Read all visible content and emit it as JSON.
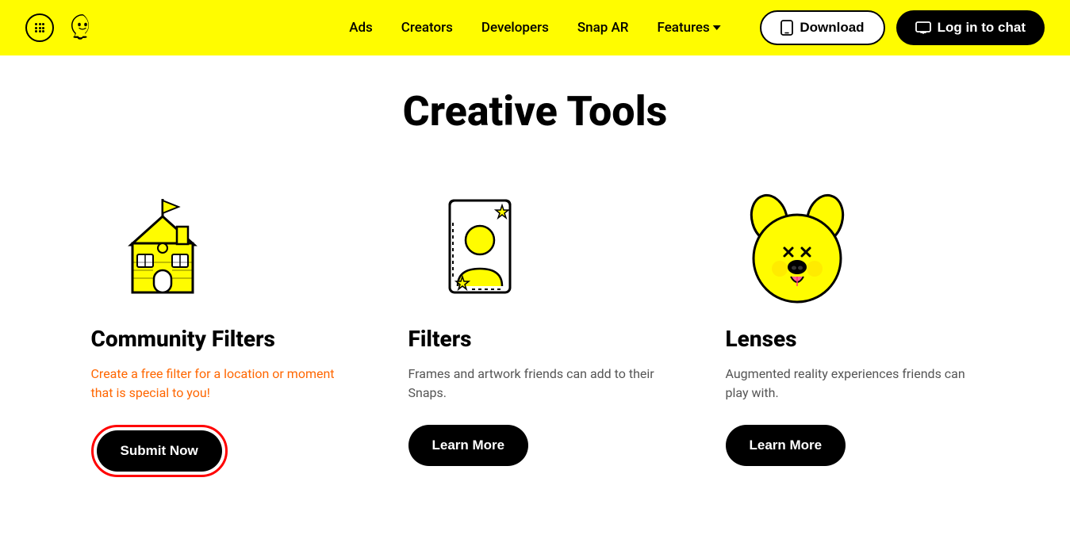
{
  "navbar": {
    "nav_links": [
      {
        "id": "ads",
        "label": "Ads"
      },
      {
        "id": "creators",
        "label": "Creators"
      },
      {
        "id": "developers",
        "label": "Developers"
      },
      {
        "id": "snap-ar",
        "label": "Snap AR"
      },
      {
        "id": "features",
        "label": "Features"
      }
    ],
    "download_label": "Download",
    "login_label": "Log in to chat"
  },
  "main": {
    "title": "Creative Tools",
    "cards": [
      {
        "id": "community-filters",
        "title": "Community Filters",
        "description_parts": [
          {
            "text": "Create a free filter for a location or\nmoment that is special to you!",
            "highlight": true
          }
        ],
        "description": "Create a free filter for a location or moment that is special to you!",
        "button_label": "Submit Now",
        "button_type": "submit"
      },
      {
        "id": "filters",
        "title": "Filters",
        "description": "Frames and artwork friends can add to their Snaps.",
        "button_label": "Learn More",
        "button_type": "learn"
      },
      {
        "id": "lenses",
        "title": "Lenses",
        "description": "Augmented reality experiences friends can play with.",
        "button_label": "Learn More",
        "button_type": "learn"
      }
    ]
  }
}
